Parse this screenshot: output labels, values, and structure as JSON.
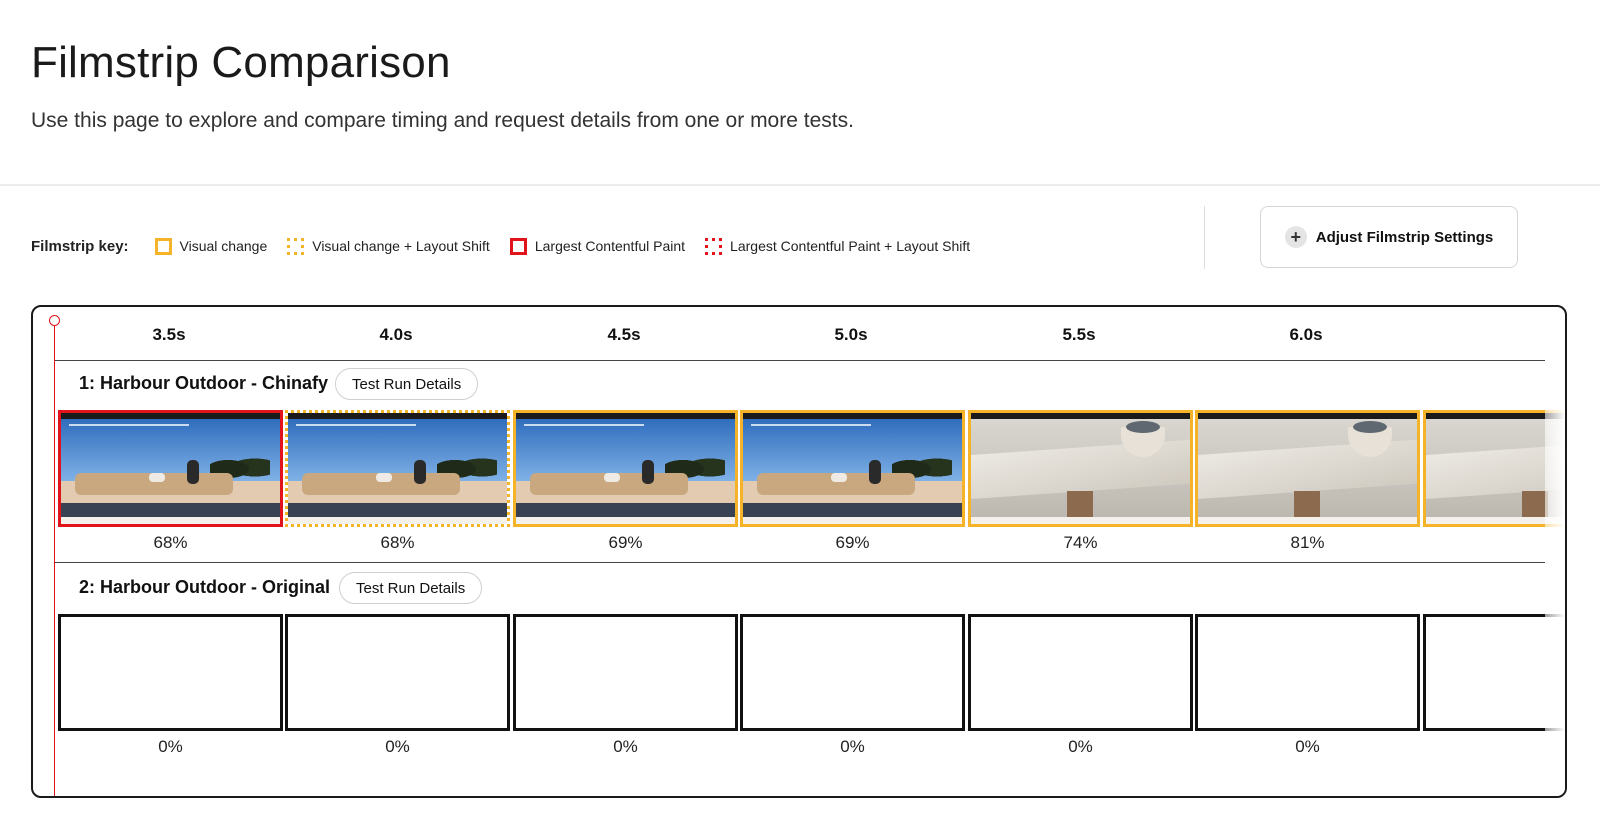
{
  "header": {
    "title": "Filmstrip Comparison",
    "subtitle": "Use this page to explore and compare timing and request details from one or more tests."
  },
  "key": {
    "title": "Filmstrip key:",
    "items": [
      {
        "label": "Visual change",
        "style": "visual"
      },
      {
        "label": "Visual change + Layout Shift",
        "style": "visual-ls"
      },
      {
        "label": "Largest Contentful Paint",
        "style": "lcp"
      },
      {
        "label": "Largest Contentful Paint + Layout Shift",
        "style": "lcp-ls"
      }
    ]
  },
  "settings": {
    "label": "Adjust Filmstrip Settings",
    "icon": "plus-icon"
  },
  "colors": {
    "visual": "#f5b32a",
    "lcp": "#e1141b",
    "blank": "#111111"
  },
  "timeline": {
    "times": [
      "3.5s",
      "4.0s",
      "4.5s",
      "5.0s",
      "5.5s",
      "6.0s"
    ]
  },
  "runs": [
    {
      "label": "1: Harbour Outdoor - Chinafy",
      "details_button": "Test Run Details",
      "frames": [
        {
          "percent": "68%",
          "style": "lcp",
          "scene": "sofa"
        },
        {
          "percent": "68%",
          "style": "visual-ls",
          "scene": "sofa"
        },
        {
          "percent": "69%",
          "style": "visual",
          "scene": "sofa"
        },
        {
          "percent": "69%",
          "style": "visual",
          "scene": "sofa"
        },
        {
          "percent": "74%",
          "style": "visual",
          "scene": "table"
        },
        {
          "percent": "81%",
          "style": "visual",
          "scene": "table"
        },
        {
          "percent": "",
          "style": "visual",
          "scene": "table"
        }
      ]
    },
    {
      "label": "2: Harbour Outdoor - Original",
      "details_button": "Test Run Details",
      "frames": [
        {
          "percent": "0%",
          "style": "blank",
          "scene": "blank"
        },
        {
          "percent": "0%",
          "style": "blank",
          "scene": "blank"
        },
        {
          "percent": "0%",
          "style": "blank",
          "scene": "blank"
        },
        {
          "percent": "0%",
          "style": "blank",
          "scene": "blank"
        },
        {
          "percent": "0%",
          "style": "blank",
          "scene": "blank"
        },
        {
          "percent": "0%",
          "style": "blank",
          "scene": "blank"
        },
        {
          "percent": "",
          "style": "blank",
          "scene": "blank"
        }
      ]
    }
  ]
}
